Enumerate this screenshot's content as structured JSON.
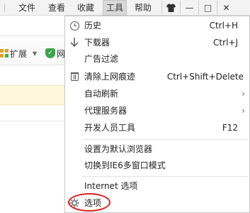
{
  "menubar": {
    "items": [
      {
        "label": "文件"
      },
      {
        "label": "查看"
      },
      {
        "label": "收藏"
      },
      {
        "label": "工具"
      },
      {
        "label": "帮助"
      }
    ],
    "window_controls": {
      "shirt_icon": "shirt-icon",
      "minimize": "—",
      "restore": "□",
      "close": "✕"
    }
  },
  "toolbar": {
    "extensions_label": "扩展",
    "extensions_dropdown": "▼",
    "shield_label": "网"
  },
  "tools_menu": {
    "items": [
      {
        "label": "历史",
        "shortcut": "Ctrl+H",
        "icon": "clock-icon"
      },
      {
        "label": "下载器",
        "shortcut": "Ctrl+J",
        "icon": "download-arrow-icon"
      },
      {
        "label": "广告过滤",
        "shortcut": ""
      },
      {
        "label": "清除上网痕迹",
        "shortcut": "Ctrl+Shift+Delete",
        "icon": "trash-icon"
      },
      {
        "label": "自动刷新",
        "submenu": "›"
      },
      {
        "label": "代理服务器",
        "submenu": "›"
      },
      {
        "label": "开发人员工具",
        "shortcut": "F12"
      },
      {
        "label": "设置为默认浏览器"
      },
      {
        "label": "切换到IE6多窗口模式"
      },
      {
        "label": "Internet 选项"
      },
      {
        "label": "选项",
        "icon": "gear-icon"
      }
    ]
  },
  "colors": {
    "highlight_ring": "#e02020",
    "active_menu_bg": "#d9d9d9"
  }
}
